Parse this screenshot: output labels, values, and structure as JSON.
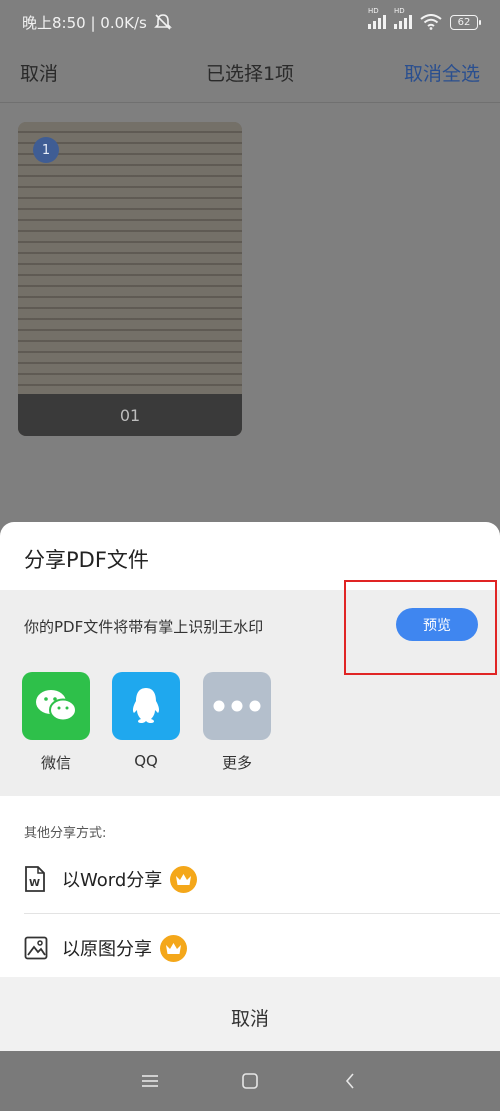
{
  "status_bar": {
    "time_speed": "晚上8:50 | 0.0K/s",
    "battery": "62",
    "signal_label_1": "HD",
    "signal_label_2": "HD"
  },
  "top_bar": {
    "cancel": "取消",
    "title": "已选择1项",
    "cancel_select_all": "取消全选"
  },
  "thumbnail": {
    "badge": "1",
    "label": "01"
  },
  "share_sheet": {
    "title": "分享PDF文件",
    "watermark_notice": "你的PDF文件将带有掌上识别王水印",
    "preview_button": "预览",
    "apps": [
      {
        "label": "微信",
        "icon": "wechat-icon",
        "color": "#2ec04a"
      },
      {
        "label": "QQ",
        "icon": "qq-icon",
        "color": "#1fa8ee"
      },
      {
        "label": "更多",
        "icon": "more-icon",
        "color": "#b4bfcc"
      }
    ],
    "other_title": "其他分享方式:",
    "options": [
      {
        "label": "以Word分享",
        "icon": "word-doc-icon"
      },
      {
        "label": "以原图分享",
        "icon": "image-icon"
      }
    ],
    "cancel": "取消",
    "highlight_color": "#e02424",
    "crown_color": "#f4a71a"
  },
  "nav_bar": {
    "icons": [
      "menu-icon",
      "home-icon",
      "back-icon"
    ]
  }
}
